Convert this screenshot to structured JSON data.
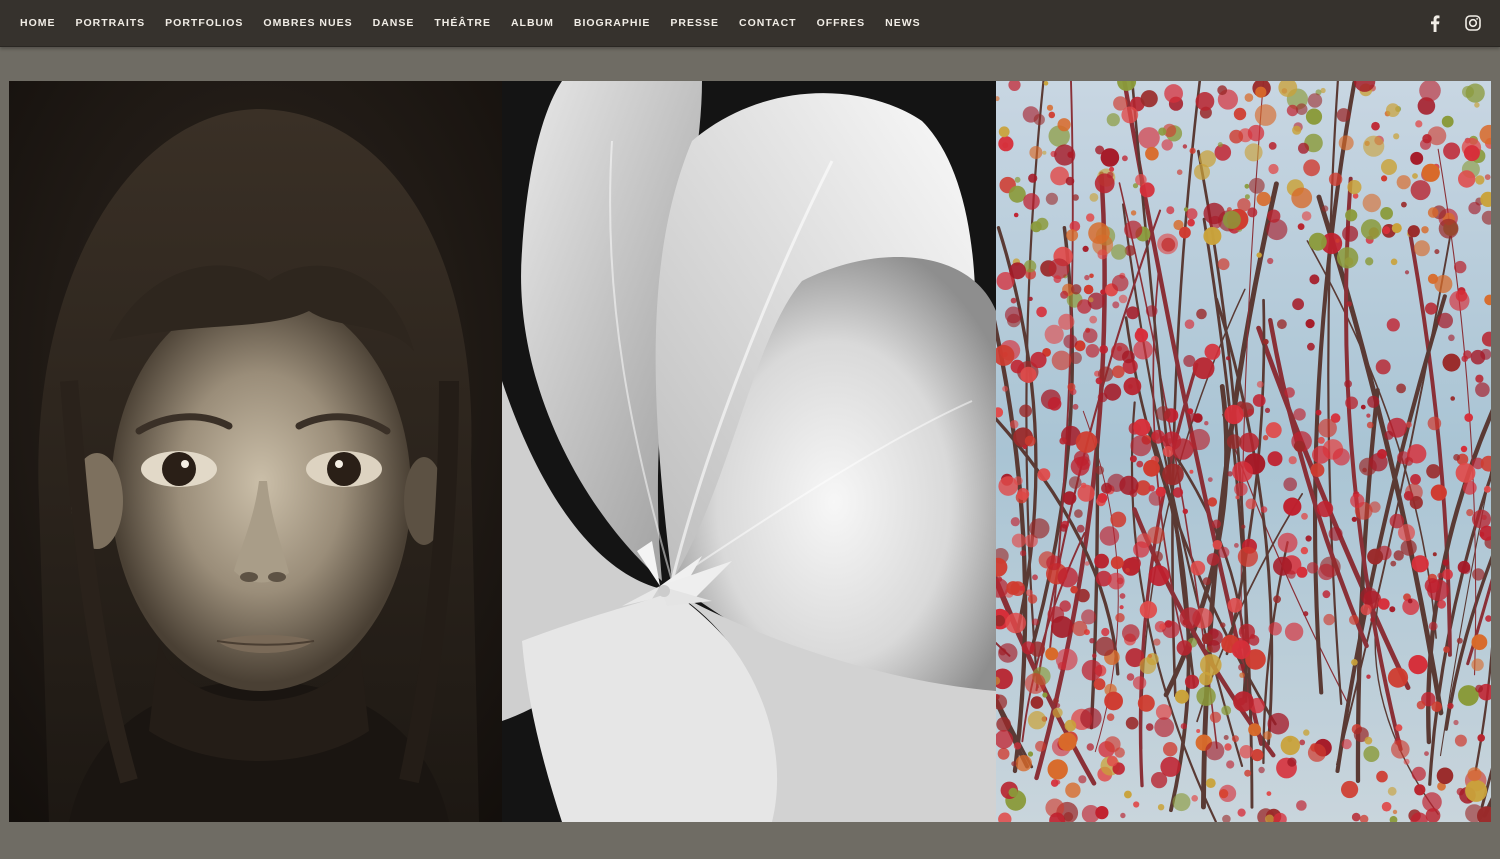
{
  "nav": {
    "items": [
      "HOME",
      "PORTRAITS",
      "PORTFOLIOS",
      "OMBRES NUES",
      "DANSE",
      "THÉÂTRE",
      "ALBUM",
      "BIOGRAPHIE",
      "PRESSE",
      "CONTACT",
      "OFFRES",
      "NEWS"
    ]
  },
  "social": {
    "icons": [
      "facebook-icon",
      "instagram-icon"
    ]
  },
  "gallery": {
    "images": [
      "girl-portrait-photo",
      "white-tulip-photo",
      "red-autumn-tree-photo"
    ]
  },
  "colors": {
    "topbar": "#36322d",
    "page_background": "#6f6c64",
    "nav_text": "#f1ede6"
  }
}
